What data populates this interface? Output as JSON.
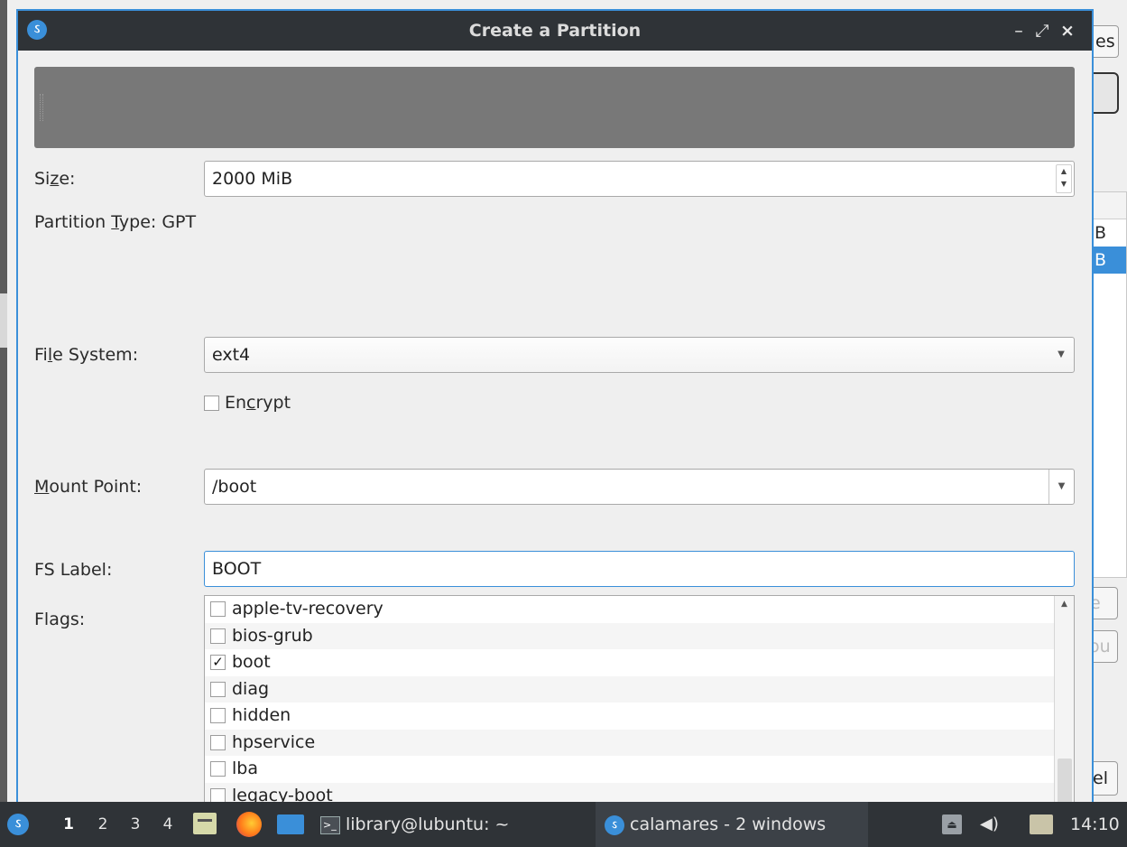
{
  "background": {
    "btn1_text": "es",
    "table_rows": [
      "B",
      "B"
    ],
    "btn3_text": "e",
    "btn4_text": "ou",
    "btn5_text": "el"
  },
  "dialog": {
    "title": "Create a Partition",
    "controls": {
      "minimize": "–",
      "maximize": "⤢",
      "close": "×"
    }
  },
  "form": {
    "size_label_pre": "Si",
    "size_label_key": "z",
    "size_label_post": "e:",
    "size_value": "2000 MiB",
    "partition_type_pre": "Partition ",
    "partition_type_key": "T",
    "partition_type_post": "ype: GPT",
    "fs_label_pre": "Fi",
    "fs_label_key": "l",
    "fs_label_post": "e System:",
    "fs_value": "ext4",
    "encrypt_pre": "En",
    "encrypt_key": "c",
    "encrypt_post": "rypt",
    "encrypt_checked": false,
    "mount_label_key": "M",
    "mount_label_post": "ount Point:",
    "mount_value": "/boot",
    "fslabel_label": "FS Label:",
    "fslabel_value": "BOOT",
    "flags_label": "Flags:",
    "flags": [
      {
        "name": "apple-tv-recovery",
        "checked": false
      },
      {
        "name": "bios-grub",
        "checked": false
      },
      {
        "name": "boot",
        "checked": true
      },
      {
        "name": "diag",
        "checked": false
      },
      {
        "name": "hidden",
        "checked": false
      },
      {
        "name": "hpservice",
        "checked": false
      },
      {
        "name": "lba",
        "checked": false
      },
      {
        "name": "legacy-boot",
        "checked": false
      }
    ]
  },
  "taskbar": {
    "start_icon": "lubuntu-logo-icon",
    "workspaces": [
      "1",
      "2",
      "3",
      "4"
    ],
    "active_workspace": "1",
    "terminal_task": "library@lubuntu: ~",
    "calamares_task": "calamares - 2 windows",
    "clock": "14:10"
  },
  "colors": {
    "accent": "#3a8fd9",
    "titlebar": "#2f3337",
    "taskbar": "#2f3337"
  }
}
